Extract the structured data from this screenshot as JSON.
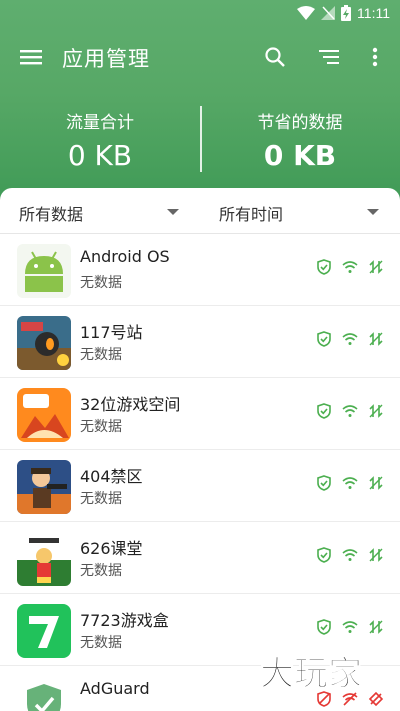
{
  "status_bar": {
    "time": "11:11"
  },
  "toolbar": {
    "title": "应用管理",
    "icons": [
      "menu-icon",
      "search-icon",
      "sort-icon",
      "more-vert-icon"
    ]
  },
  "stats": {
    "total_label": "流量合计",
    "total_value": "0 KB",
    "saved_label": "节省的数据",
    "saved_value": "0 KB"
  },
  "filters": {
    "data_filter": "所有数据",
    "time_filter": "所有时间"
  },
  "apps": [
    {
      "name": "Android OS",
      "sub": "无数据"
    },
    {
      "name": "117号站",
      "sub": "无数据"
    },
    {
      "name": "32位游戏空间",
      "sub": "无数据"
    },
    {
      "name": "404禁区",
      "sub": "无数据"
    },
    {
      "name": "626课堂",
      "sub": "无数据"
    },
    {
      "name": "7723游戏盒",
      "sub": "无数据"
    },
    {
      "name": "AdGuard",
      "sub": ""
    }
  ],
  "colors": {
    "header_green": "#57a866",
    "action_green": "#4caf50",
    "action_red": "#e53935"
  },
  "watermark": {
    "text": "大玩家"
  }
}
